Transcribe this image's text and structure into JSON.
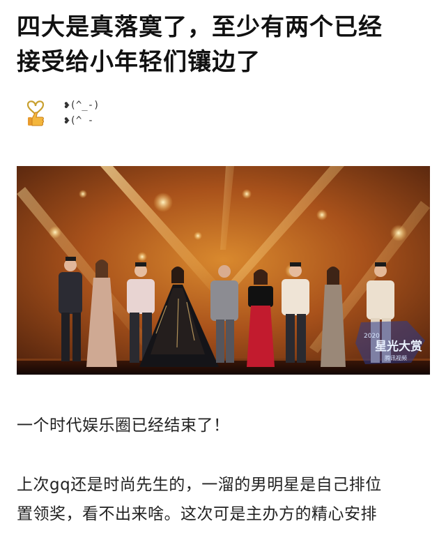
{
  "article": {
    "title_lines": [
      "四大是真落寞了，至少有两个已经",
      "接受给小年轻们镶边了"
    ]
  },
  "author": {
    "avatar_icon": "heart-thumbs-up-icon",
    "name_line1": "❥(^_-)",
    "name_line2": "❥(^ -"
  },
  "photo": {
    "logo_year": "2020",
    "logo_text": "星光大赏",
    "logo_sub": "腾讯视频"
  },
  "paragraphs": [
    {
      "lines": [
        "一个时代娱乐圈已经结束了！"
      ]
    },
    {
      "lines": [
        "上次gq还是时尚先生的，一溜的男明星是自己排位",
        "置领奖，看不出来啥。这次可是主办方的精心安排"
      ]
    }
  ],
  "colors": {
    "accent": "#c8962e",
    "stage": "#6b3412"
  }
}
